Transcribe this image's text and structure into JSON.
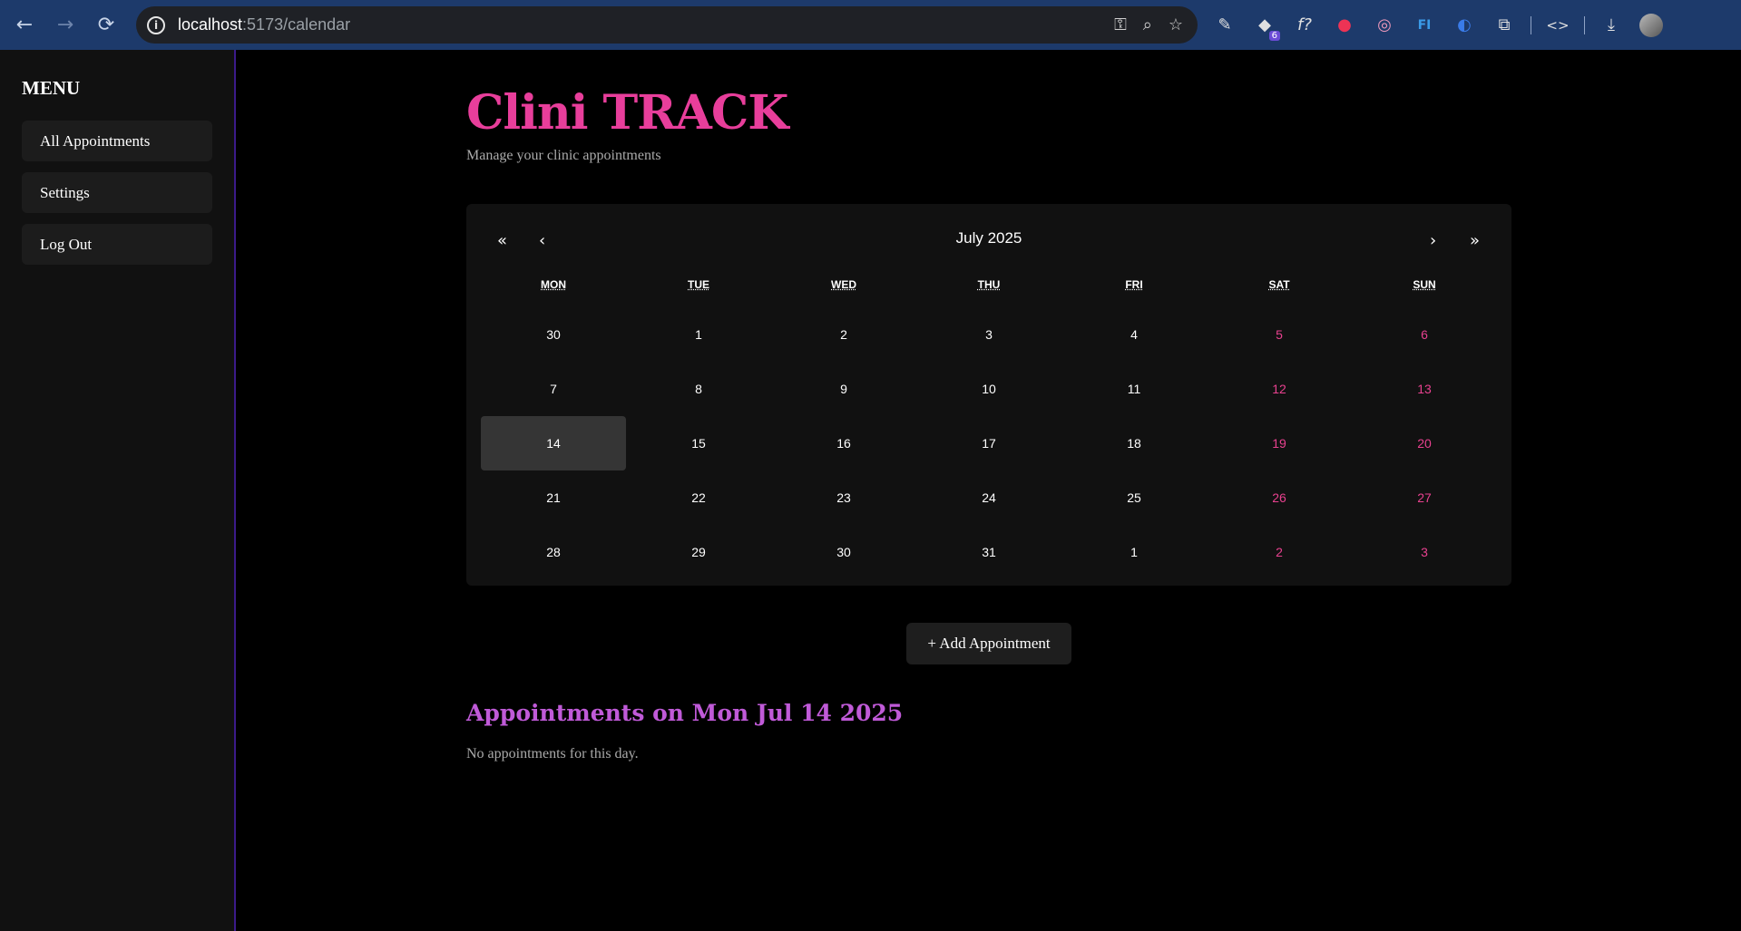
{
  "browser": {
    "url_host": "localhost",
    "url_rest": ":5173/calendar",
    "extension_badge": "6",
    "icons": [
      "back-icon",
      "forward-icon",
      "reload-icon",
      "info-icon",
      "key-icon",
      "zoom-icon",
      "star-icon",
      "eyedropper-icon",
      "extension-icon",
      "formula-icon",
      "color-icon",
      "glasses-icon",
      "fi-icon",
      "sync-icon",
      "puzzle-icon",
      "code-icon",
      "download-icon",
      "avatar"
    ]
  },
  "sidebar": {
    "title": "MENU",
    "items": [
      {
        "label": "All Appointments"
      },
      {
        "label": "Settings"
      },
      {
        "label": "Log Out"
      }
    ]
  },
  "header": {
    "title": "Clini TRACK",
    "subtitle": "Manage your clinic appointments"
  },
  "calendar": {
    "month_label": "July 2025",
    "nav": {
      "prev_year": "«",
      "prev_month": "‹",
      "next_month": "›",
      "next_year": "»"
    },
    "weekdays": [
      "MON",
      "TUE",
      "WED",
      "THU",
      "FRI",
      "SAT",
      "SUN"
    ],
    "weeks": [
      [
        "30",
        "1",
        "2",
        "3",
        "4",
        "5",
        "6"
      ],
      [
        "7",
        "8",
        "9",
        "10",
        "11",
        "12",
        "13"
      ],
      [
        "14",
        "15",
        "16",
        "17",
        "18",
        "19",
        "20"
      ],
      [
        "21",
        "22",
        "23",
        "24",
        "25",
        "26",
        "27"
      ],
      [
        "28",
        "29",
        "30",
        "31",
        "1",
        "2",
        "3"
      ]
    ],
    "selected": {
      "week": 2,
      "day": 0
    },
    "weekend_color": "#e8418f",
    "selected_color": "#353535"
  },
  "actions": {
    "add_label": "+ Add Appointment"
  },
  "appointments": {
    "heading": "Appointments on Mon Jul 14 2025",
    "empty_text": "No appointments for this day."
  },
  "colors": {
    "brand": "#e83e9b",
    "heading_accent": "#c05ad8",
    "browser_bar": "#1d3a6b"
  }
}
